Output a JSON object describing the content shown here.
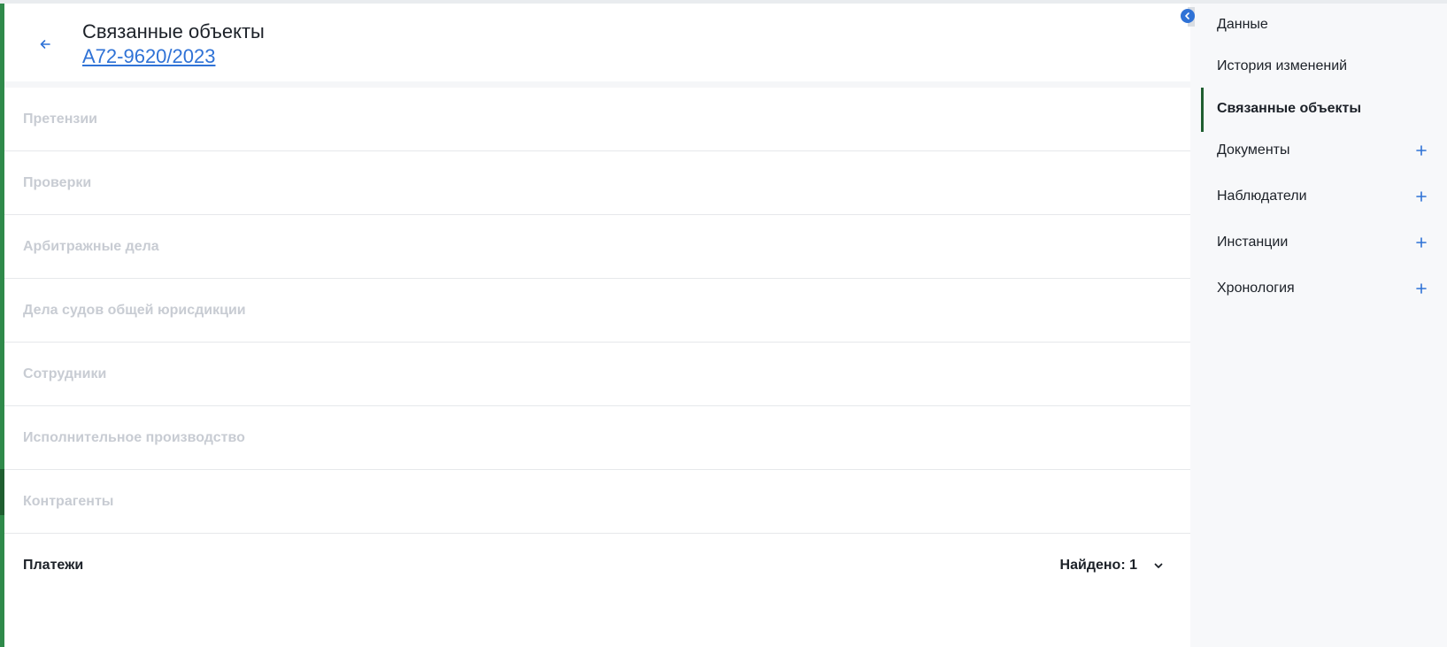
{
  "header": {
    "back_icon": "arrow-left-icon",
    "title": "Связанные объекты",
    "case_number": "А72-9620/2023"
  },
  "sections": [
    {
      "label": "Претензии",
      "active": false
    },
    {
      "label": "Проверки",
      "active": false
    },
    {
      "label": "Арбитражные дела",
      "active": false
    },
    {
      "label": "Дела судов общей юрисдикции",
      "active": false
    },
    {
      "label": "Сотрудники",
      "active": false
    },
    {
      "label": "Исполнительное производство",
      "active": false
    },
    {
      "label": "Контрагенты",
      "active": false
    },
    {
      "label": "Платежи",
      "active": true,
      "count_text": "Найдено: 1"
    }
  ],
  "nav": {
    "collapse_icon": "chevron-left-icon",
    "items": [
      {
        "label": "Данные",
        "active": false,
        "has_add": false
      },
      {
        "label": "История изменений",
        "active": false,
        "has_add": false
      },
      {
        "label": "Связанные объекты",
        "active": true,
        "has_add": false
      },
      {
        "label": "Документы",
        "active": false,
        "has_add": true
      },
      {
        "label": "Наблюдатели",
        "active": false,
        "has_add": true
      },
      {
        "label": "Инстанции",
        "active": false,
        "has_add": true
      },
      {
        "label": "Хронология",
        "active": false,
        "has_add": true
      }
    ]
  },
  "colors": {
    "accent_blue": "#2f72d6",
    "brand_green": "#2f8a4a",
    "active_bar_green": "#1f5e30",
    "muted_text": "#c8ccd3"
  }
}
